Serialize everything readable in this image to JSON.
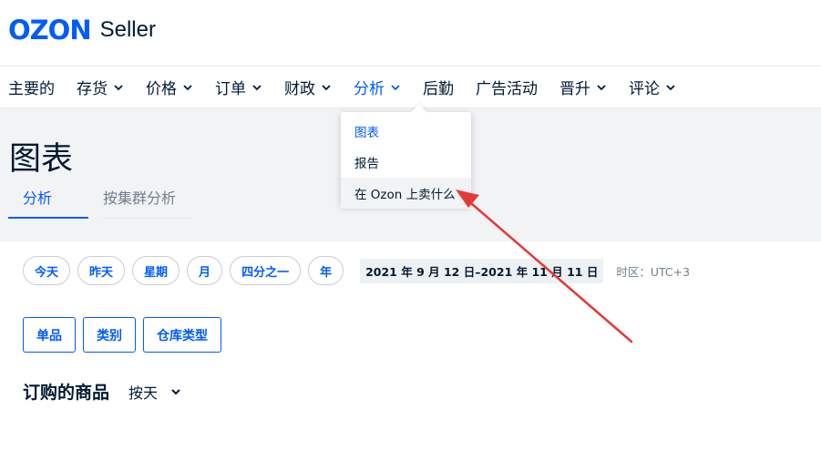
{
  "header": {
    "logo": "OZON",
    "logo_sub": "Seller"
  },
  "nav": [
    {
      "label": "主要的",
      "has_chevron": false
    },
    {
      "label": "存货",
      "has_chevron": true
    },
    {
      "label": "价格",
      "has_chevron": true
    },
    {
      "label": "订单",
      "has_chevron": true
    },
    {
      "label": "财政",
      "has_chevron": true
    },
    {
      "label": "分析",
      "has_chevron": true,
      "active": true
    },
    {
      "label": "后勤",
      "has_chevron": false
    },
    {
      "label": "广告活动",
      "has_chevron": false
    },
    {
      "label": "晋升",
      "has_chevron": true
    },
    {
      "label": "评论",
      "has_chevron": true
    }
  ],
  "page": {
    "title": "图表"
  },
  "tabs": [
    {
      "label": "分析"
    },
    {
      "label": "按集群分析"
    }
  ],
  "dropdown": {
    "items": [
      {
        "label": "图表"
      },
      {
        "label": "报告"
      },
      {
        "label": "在 Ozon 上卖什么"
      }
    ]
  },
  "periods": [
    {
      "label": "今天"
    },
    {
      "label": "昨天"
    },
    {
      "label": "星期"
    },
    {
      "label": "月"
    },
    {
      "label": "四分之一"
    },
    {
      "label": "年"
    }
  ],
  "date_range": "2021 年 9 月 12 日–2021 年 11 月 11 日",
  "timezone": "时区：UTC+3",
  "filters": [
    {
      "label": "单品"
    },
    {
      "label": "类别"
    },
    {
      "label": "仓库类型"
    }
  ],
  "section": {
    "title": "订购的商品",
    "group_by": "按天"
  },
  "colors": {
    "brand": "#005bff",
    "text": "#001a34",
    "muted": "#707f8d",
    "annotation_arrow": "#e53935"
  },
  "icons": {
    "chevron": "chevron-down-icon"
  }
}
